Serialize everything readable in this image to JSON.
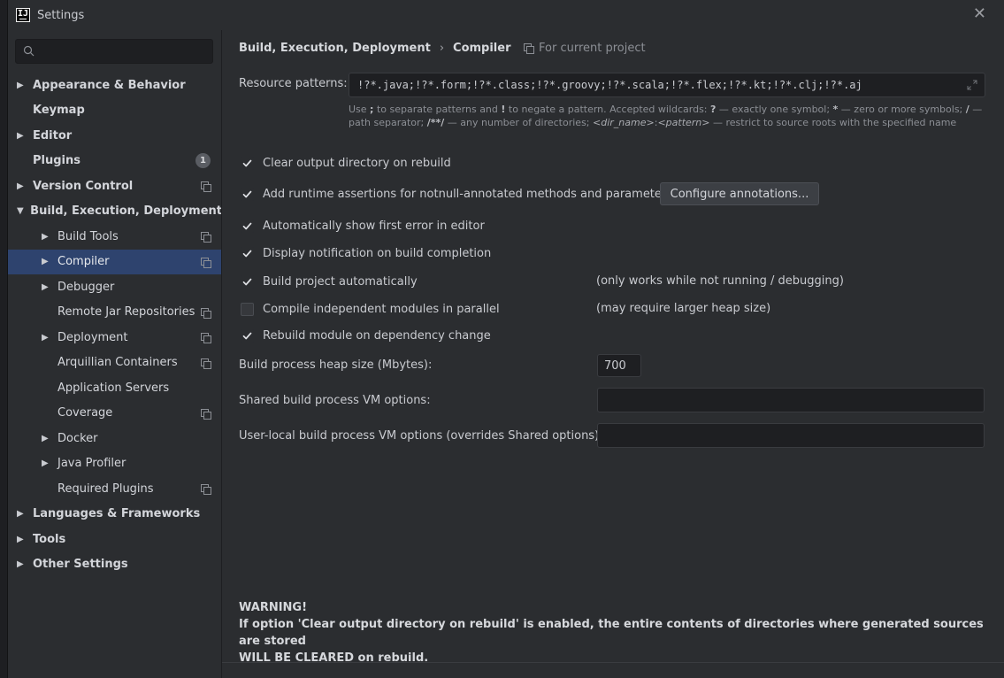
{
  "window": {
    "title": "Settings",
    "logo_text": "IJ",
    "close_glyph": "✕"
  },
  "search": {
    "placeholder": "",
    "value": ""
  },
  "sidebar": {
    "items": [
      {
        "label": "Appearance & Behavior",
        "level": 0,
        "arrow": "▶",
        "bold": true
      },
      {
        "label": "Keymap",
        "level": 0,
        "arrow": "",
        "bold": true
      },
      {
        "label": "Editor",
        "level": 0,
        "arrow": "▶",
        "bold": true
      },
      {
        "label": "Plugins",
        "level": 0,
        "arrow": "",
        "bold": true,
        "count": "1"
      },
      {
        "label": "Version Control",
        "level": 0,
        "arrow": "▶",
        "bold": true,
        "project_icon": true
      },
      {
        "label": "Build, Execution, Deployment",
        "level": 0,
        "arrow": "▼",
        "bold": true
      },
      {
        "label": "Build Tools",
        "level": 1,
        "arrow": "▶",
        "project_icon": true
      },
      {
        "label": "Compiler",
        "level": 1,
        "arrow": "▶",
        "project_icon": true,
        "selected": true
      },
      {
        "label": "Debugger",
        "level": 1,
        "arrow": "▶"
      },
      {
        "label": "Remote Jar Repositories",
        "level": 1,
        "arrow": "",
        "project_icon": true
      },
      {
        "label": "Deployment",
        "level": 1,
        "arrow": "▶",
        "project_icon": true
      },
      {
        "label": "Arquillian Containers",
        "level": 1,
        "arrow": "",
        "project_icon": true
      },
      {
        "label": "Application Servers",
        "level": 1,
        "arrow": ""
      },
      {
        "label": "Coverage",
        "level": 1,
        "arrow": "",
        "project_icon": true
      },
      {
        "label": "Docker",
        "level": 1,
        "arrow": "▶"
      },
      {
        "label": "Java Profiler",
        "level": 1,
        "arrow": "▶"
      },
      {
        "label": "Required Plugins",
        "level": 1,
        "arrow": "",
        "project_icon": true
      },
      {
        "label": "Languages & Frameworks",
        "level": 0,
        "arrow": "▶",
        "bold": true
      },
      {
        "label": "Tools",
        "level": 0,
        "arrow": "▶",
        "bold": true
      },
      {
        "label": "Other Settings",
        "level": 0,
        "arrow": "▶",
        "bold": true
      }
    ]
  },
  "header": {
    "breadcrumb_parent": "Build, Execution, Deployment",
    "breadcrumb_sep": "›",
    "breadcrumb_current": "Compiler",
    "scope_note": "For current project"
  },
  "resource": {
    "label": "Resource patterns:",
    "value": "!?*.java;!?*.form;!?*.class;!?*.groovy;!?*.scala;!?*.flex;!?*.kt;!?*.clj;!?*.aj",
    "help": {
      "t1": "Use ",
      "b1": ";",
      "t2": " to separate patterns and ",
      "b2": "!",
      "t3": " to negate a pattern. Accepted wildcards: ",
      "b3": "?",
      "t4": " — exactly one symbol; ",
      "b4": "*",
      "t5": " — zero or more symbols; ",
      "b5": "/",
      "t6": " — path separator; ",
      "b6": "/**/",
      "t7": " — any number of directories; ",
      "i1": "<dir_name>",
      "t8": ":",
      "i2": "<pattern>",
      "t9": " — restrict to source roots with the specified name"
    }
  },
  "options": {
    "clear_output": {
      "label": "Clear output directory on rebuild",
      "checked": true
    },
    "runtime_assertions": {
      "label": "Add runtime assertions for notnull-annotated methods and parameters",
      "checked": true
    },
    "configure_annotations": "Configure annotations...",
    "show_first_error": {
      "label": "Automatically show first error in editor",
      "checked": true
    },
    "display_notification": {
      "label": "Display notification on build completion",
      "checked": true
    },
    "build_automatically": {
      "label": "Build project automatically",
      "checked": true,
      "note": "(only works while not running / debugging)"
    },
    "compile_parallel": {
      "label": "Compile independent modules in parallel",
      "checked": false,
      "note": "(may require larger heap size)"
    },
    "rebuild_on_dependency": {
      "label": "Rebuild module on dependency change",
      "checked": true
    }
  },
  "heap": {
    "label": "Build process heap size (Mbytes):",
    "value": "700"
  },
  "shared_vm": {
    "label": "Shared build process VM options:",
    "value": ""
  },
  "user_vm": {
    "label": "User-local build process VM options (overrides Shared options):",
    "value": ""
  },
  "warning": {
    "title": "WARNING!",
    "line1": "If option 'Clear output directory on rebuild' is enabled, the entire contents of directories where generated sources are stored",
    "line2": "WILL BE CLEARED on rebuild."
  },
  "colors": {
    "selection": "#2e436e",
    "background": "#2b2d30",
    "input_bg": "#1e1f22"
  }
}
